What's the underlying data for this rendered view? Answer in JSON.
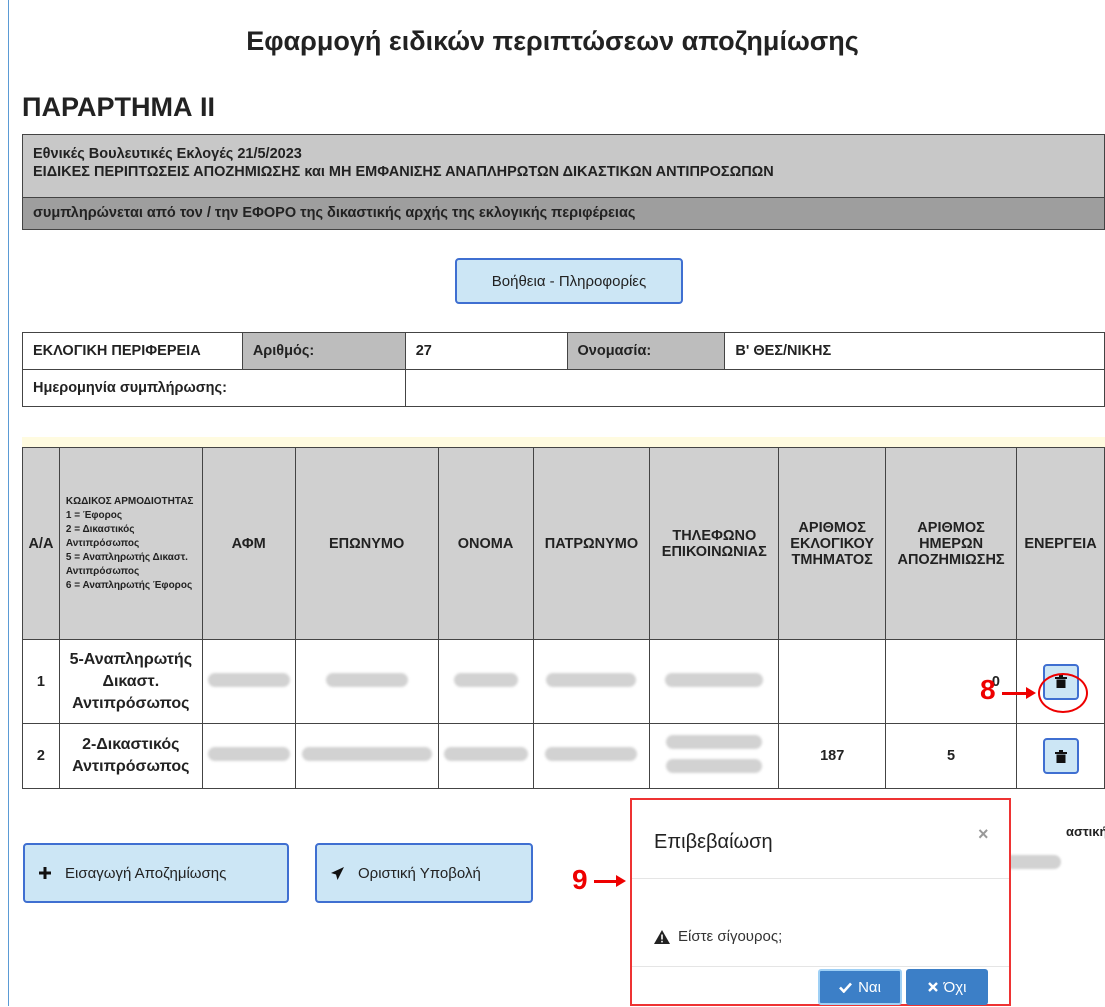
{
  "page": {
    "title": "Εφαρμογή ειδικών περιπτώσεων αποζημίωσης",
    "annex": "ΠΑΡΑΡΤΗΜΑ ΙΙ",
    "header_line1": "Εθνικές Βουλευτικές Εκλογές 21/5/2023",
    "header_line2": "ΕΙΔΙΚΕΣ ΠΕΡΙΠΤΩΣΕΙΣ ΑΠΟΖΗΜΙΩΣΗΣ και ΜΗ ΕΜΦΑΝΙΣΗΣ ΑΝΑΠΛΗΡΩΤΩΝ ΔΙΚΑΣΤΙΚΩΝ ΑΝΤΙΠΡΟΣΩΠΩΝ",
    "header_line3": "συμπληρώνεται από τον / την ΕΦΟΡΟ της δικαστικής αρχής της εκλογικής περιφέρειας",
    "help_button": "Βοήθεια - Πληροφορίες"
  },
  "district": {
    "label": "ΕΚΛΟΓΙΚΗ ΠΕΡΙΦΕΡΕΙΑ",
    "number_label": "Αριθμός:",
    "number_value": "27",
    "name_label": "Ονομασία:",
    "name_value": "Β' ΘΕΣ/ΝΙΚΗΣ",
    "date_label": "Ημερομηνία συμπλήρωσης:",
    "date_value": ""
  },
  "table": {
    "headers": {
      "aa": "Α/Α",
      "code_title": "ΚΩΔΙΚΟΣ ΑΡΜΟΔΙΟΤΗΤΑΣ",
      "code_1": "1 = Έφορος",
      "code_2": "2 = Δικαστικός Αντιπρόσωπος",
      "code_5": "5 = Αναπληρωτής Δικαστ. Αντιπρόσωπος",
      "code_6": "6 = Αναπληρωτής Έφορος",
      "afm": "ΑΦΜ",
      "surname": "ΕΠΩΝΥΜΟ",
      "name": "ΟΝΟΜΑ",
      "father": "ΠΑΤΡΩΝΥΜΟ",
      "phone": "ΤΗΛΕΦΩΝΟ ΕΠΙΚΟΙΝΩΝΙΑΣ",
      "section": "ΑΡΙΘΜΟΣ ΕΚΛΟΓΙΚΟΥ ΤΜΗΜΑΤΟΣ",
      "days": "ΑΡΙΘΜΟΣ ΗΜΕΡΩΝ ΑΠΟΖΗΜΙΩΣΗΣ",
      "action": "ΕΝΕΡΓΕΙΑ"
    },
    "rows": [
      {
        "aa": "1",
        "role": "5-Αναπληρωτής Δικαστ. Αντιπρόσωπος",
        "section": "",
        "days": "0"
      },
      {
        "aa": "2",
        "role": "2-Δικαστικός Αντιπρόσωπος",
        "section": "187",
        "days": "5"
      }
    ]
  },
  "annotations": {
    "step8": "8",
    "step9": "9"
  },
  "buttons": {
    "add": "Εισαγωγή Αποζημίωσης",
    "submit": "Οριστική Υποβολή"
  },
  "side_text": "αστικής Αρχή",
  "modal": {
    "title": "Επιβεβαίωση",
    "close": "×",
    "message": "Είστε σίγουρος;",
    "yes": "Ναι",
    "no": "Όχι"
  },
  "colors": {
    "button_bg": "#cce6f5",
    "button_border": "#3f6fd1",
    "modal_button": "#3c7fc7",
    "annotation": "#e00000"
  },
  "icons": [
    "trash-icon",
    "plus-icon",
    "paper-plane-icon",
    "warning-icon",
    "check-icon",
    "close-icon"
  ]
}
